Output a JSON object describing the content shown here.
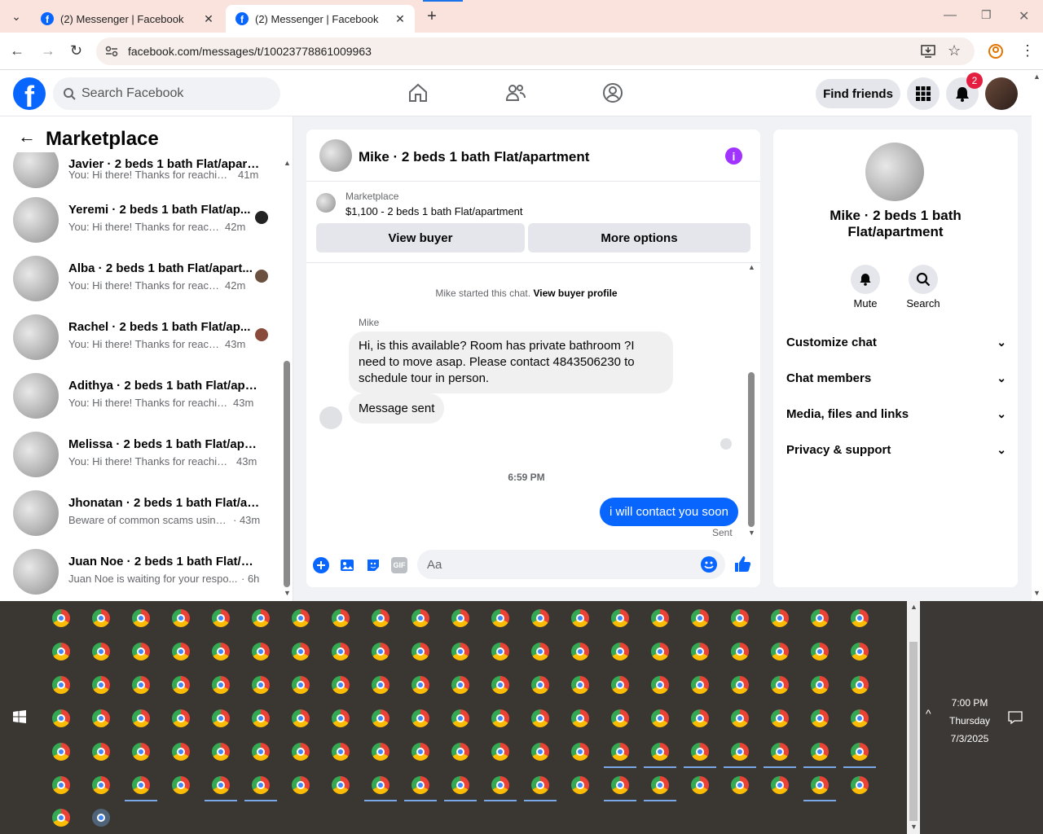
{
  "browser": {
    "tabs": [
      {
        "title": "(2) Messenger | Facebook"
      },
      {
        "title": "(2) Messenger | Facebook"
      }
    ],
    "url": "facebook.com/messages/t/10023778861009963"
  },
  "header": {
    "search_placeholder": "Search Facebook",
    "find_friends": "Find friends",
    "notif_count": "2"
  },
  "sidebar": {
    "title": "Marketplace",
    "partial_item": {
      "name": "Javier · 2 beds 1 bath Flat/apartment",
      "preview": "You: Hi there! Thanks for reaching...",
      "time": "41m"
    },
    "items": [
      {
        "name": "Yeremi · 2 beds 1 bath Flat/ap...",
        "preview": "You: Hi there! Thanks for reach...",
        "time": "42m"
      },
      {
        "name": "Alba · 2 beds 1 bath Flat/apart...",
        "preview": "You: Hi there! Thanks for reach...",
        "time": "42m"
      },
      {
        "name": "Rachel · 2 beds 1 bath Flat/ap...",
        "preview": "You: Hi there! Thanks for reach...",
        "time": "43m"
      },
      {
        "name": "Adithya · 2 beds 1 bath Flat/apar...",
        "preview": "You: Hi there! Thanks for reaching...",
        "time": "43m"
      },
      {
        "name": "Melissa · 2 beds 1 bath Flat/apar...",
        "preview": "You: Hi there! Thanks for reaching...",
        "time": "43m"
      },
      {
        "name": "Jhonatan · 2 beds 1 bath Flat/ap...",
        "preview": "Beware of common scams using ...",
        "time": "· 43m"
      },
      {
        "name": "Juan Noe · 2 beds 1 bath Flat/ap...",
        "preview": "Juan Noe is waiting for your respo...",
        "time": "· 6h"
      }
    ]
  },
  "chat": {
    "title": "Mike · 2 beds 1 bath Flat/apartment",
    "listing_label": "Marketplace",
    "listing_detail": "$1,100 - 2 beds 1 bath Flat/apartment",
    "view_buyer": "View buyer",
    "more_options": "More options",
    "started_text": "Mike started this chat.",
    "view_profile": "View buyer profile",
    "sender": "Mike",
    "msg1": "Hi, is this available? Room has private bathroom ?I need to move asap. Please contact 4843506230 to schedule tour in person.",
    "msg2": "Message sent",
    "timestamp": "6:59 PM",
    "msg3": "i will contact you soon",
    "status": "Sent",
    "input_placeholder": "Aa"
  },
  "details": {
    "name": "Mike · 2 beds 1 bath Flat/apartment",
    "mute": "Mute",
    "search": "Search",
    "sections": [
      "Customize chat",
      "Chat members",
      "Media, files and links",
      "Privacy & support"
    ]
  },
  "taskbar": {
    "time": "7:00 PM",
    "day": "Thursday",
    "date": "7/3/2025"
  }
}
